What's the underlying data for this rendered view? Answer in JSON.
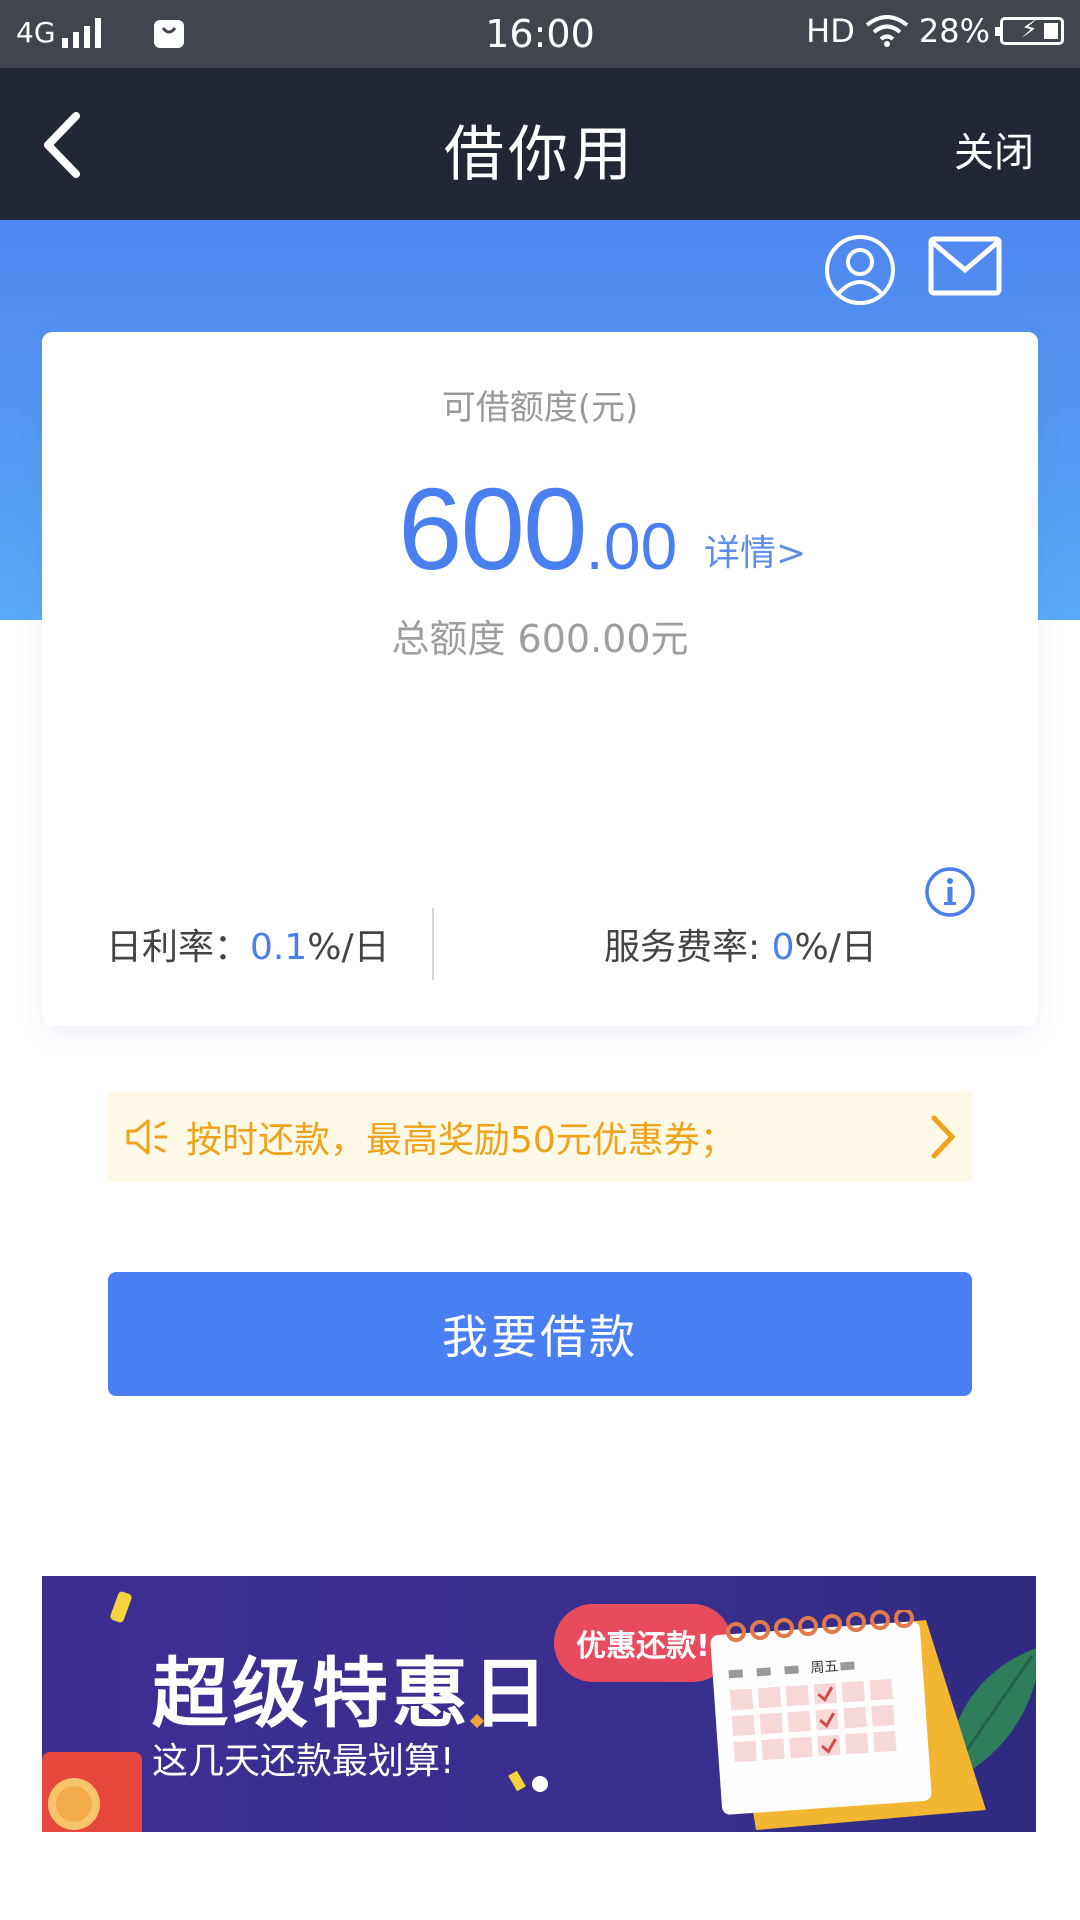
{
  "status_bar": {
    "network": "4G",
    "time": "16:00",
    "hd": "HD",
    "battery": "28%"
  },
  "nav": {
    "title": "借你用",
    "close_label": "关闭"
  },
  "card": {
    "label": "可借额度(元)",
    "amount_int": "600",
    "amount_dec": ".00",
    "detail_link": "详情>",
    "total": "总额度 600.00元",
    "daily_rate_label": "日利率：",
    "daily_rate_value": "0.1",
    "daily_rate_unit": "%/日",
    "fee_rate_label": "服务费率: ",
    "fee_rate_value": "0",
    "fee_rate_unit": "%/日"
  },
  "notice": {
    "text": "按时还款，最高奖励50元优惠券；"
  },
  "cta": {
    "label": "我要借款"
  },
  "banner": {
    "headline": "超级特惠日",
    "subtitle": "这几天还款最划算!",
    "bubble": "优惠还款!",
    "calendar_day": "周五"
  },
  "colors": {
    "accent": "#4a7ff4",
    "navbar": "#212735",
    "notice_text": "#f0a21a"
  }
}
